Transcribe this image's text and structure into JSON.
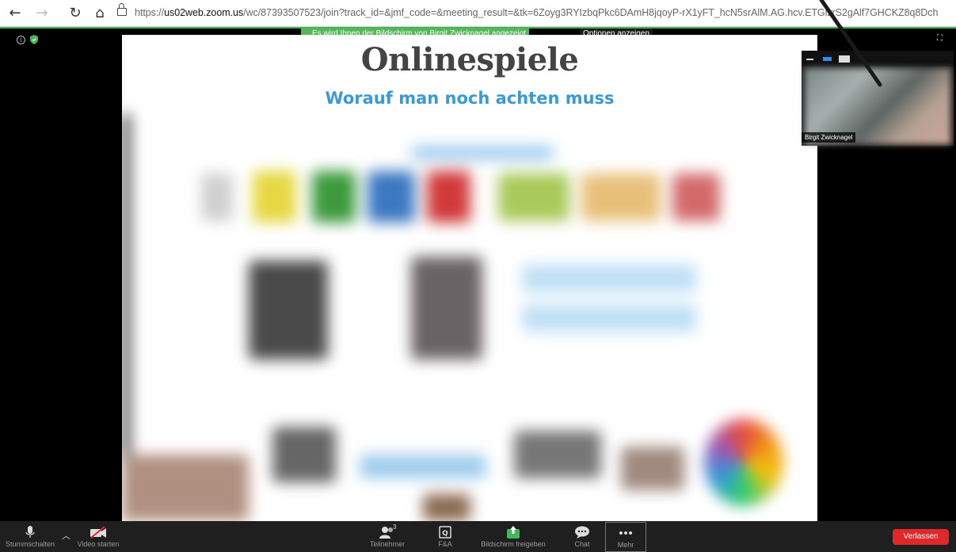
{
  "browser": {
    "back_icon": "←",
    "forward_icon": "→",
    "reload_icon": "↻",
    "home_icon": "⌂",
    "url_prefix": "https://",
    "url_host": "us02web.zoom.us",
    "url_path": "/wc/87393507523/join?track_id=&jmf_code=&meeting_result=&tk=6Zoyg3RYIzbqPkc6DAmH8jqoyP-rX1yFT_hcN5srAlM.AG.hcv.ETGlzrS2gAlf7GHCKZ8q8Dch"
  },
  "meeting": {
    "share_notice": "Es wird Ihnen der Bildschirm von Birgit Zwicknagel angezeigt",
    "view_options": "Optionen anzeigen",
    "shield_color": "#46b45a"
  },
  "slide": {
    "title": "Onlinespiele",
    "subtitle": "Worauf man noch achten muss"
  },
  "video": {
    "participant_name": "Birgit Zwicknagel"
  },
  "toolbar": {
    "mute_label": "Stummschalten",
    "video_label": "Video starten",
    "participants_label": "Teilnehmer",
    "participants_count": "3",
    "qa_label": "F&A",
    "share_label": "Bildschirm freigeben",
    "share_color": "#46b45a",
    "chat_label": "Chat",
    "more_label": "Mehr",
    "leave_label": "Verlassen",
    "leave_color": "#e02828"
  }
}
